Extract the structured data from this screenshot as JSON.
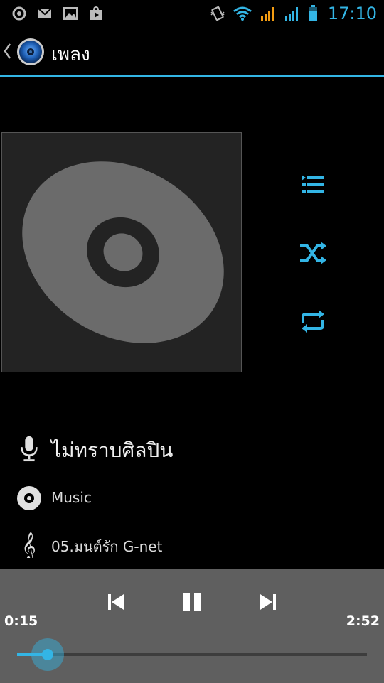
{
  "status_bar": {
    "time": "17:10",
    "icons_left": [
      "settings-notification-icon",
      "gmail-icon",
      "gallery-icon",
      "play-store-icon"
    ],
    "icons_right": [
      "vibrate-icon",
      "wifi-icon",
      "signal-sim1-icon",
      "signal-sim2-icon",
      "battery-icon"
    ]
  },
  "action_bar": {
    "title": "เพลง",
    "app_icon": "music-speaker-icon"
  },
  "track": {
    "artist": "ไม่ทราบศิลปิน",
    "album": "Music",
    "title": "05.มนต์รัก G-net"
  },
  "side_controls": [
    "playlist-icon",
    "shuffle-icon",
    "repeat-icon"
  ],
  "playback": {
    "current_time": "0:15",
    "total_time": "2:52",
    "progress_fraction": 0.087
  },
  "colors": {
    "accent": "#33b5e5",
    "background": "#000000",
    "panel": "#5f5f5f"
  }
}
